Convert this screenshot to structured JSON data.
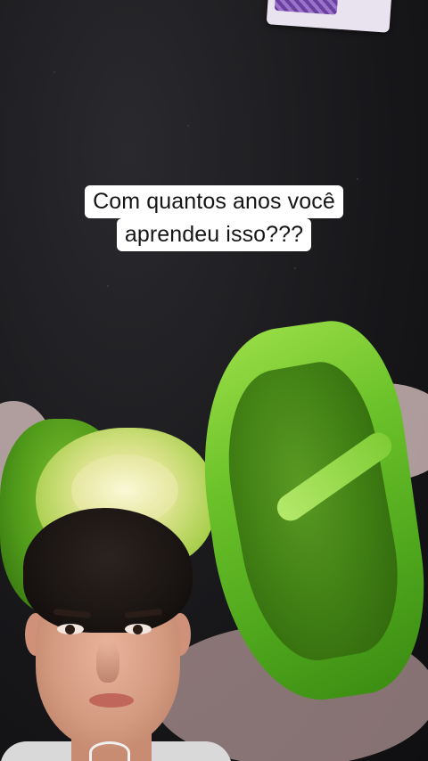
{
  "caption": {
    "line1": "Com quantos anos você",
    "line2": "aprendeu isso???"
  },
  "colors": {
    "caption_bg": "#ffffff",
    "caption_text": "#161616",
    "pepper_green": "#6cc22a",
    "background": "#17171a"
  },
  "scene_elements": [
    "fabric-background",
    "purple-paper-card",
    "green-bell-pepper",
    "gloved-hands",
    "person-face"
  ]
}
